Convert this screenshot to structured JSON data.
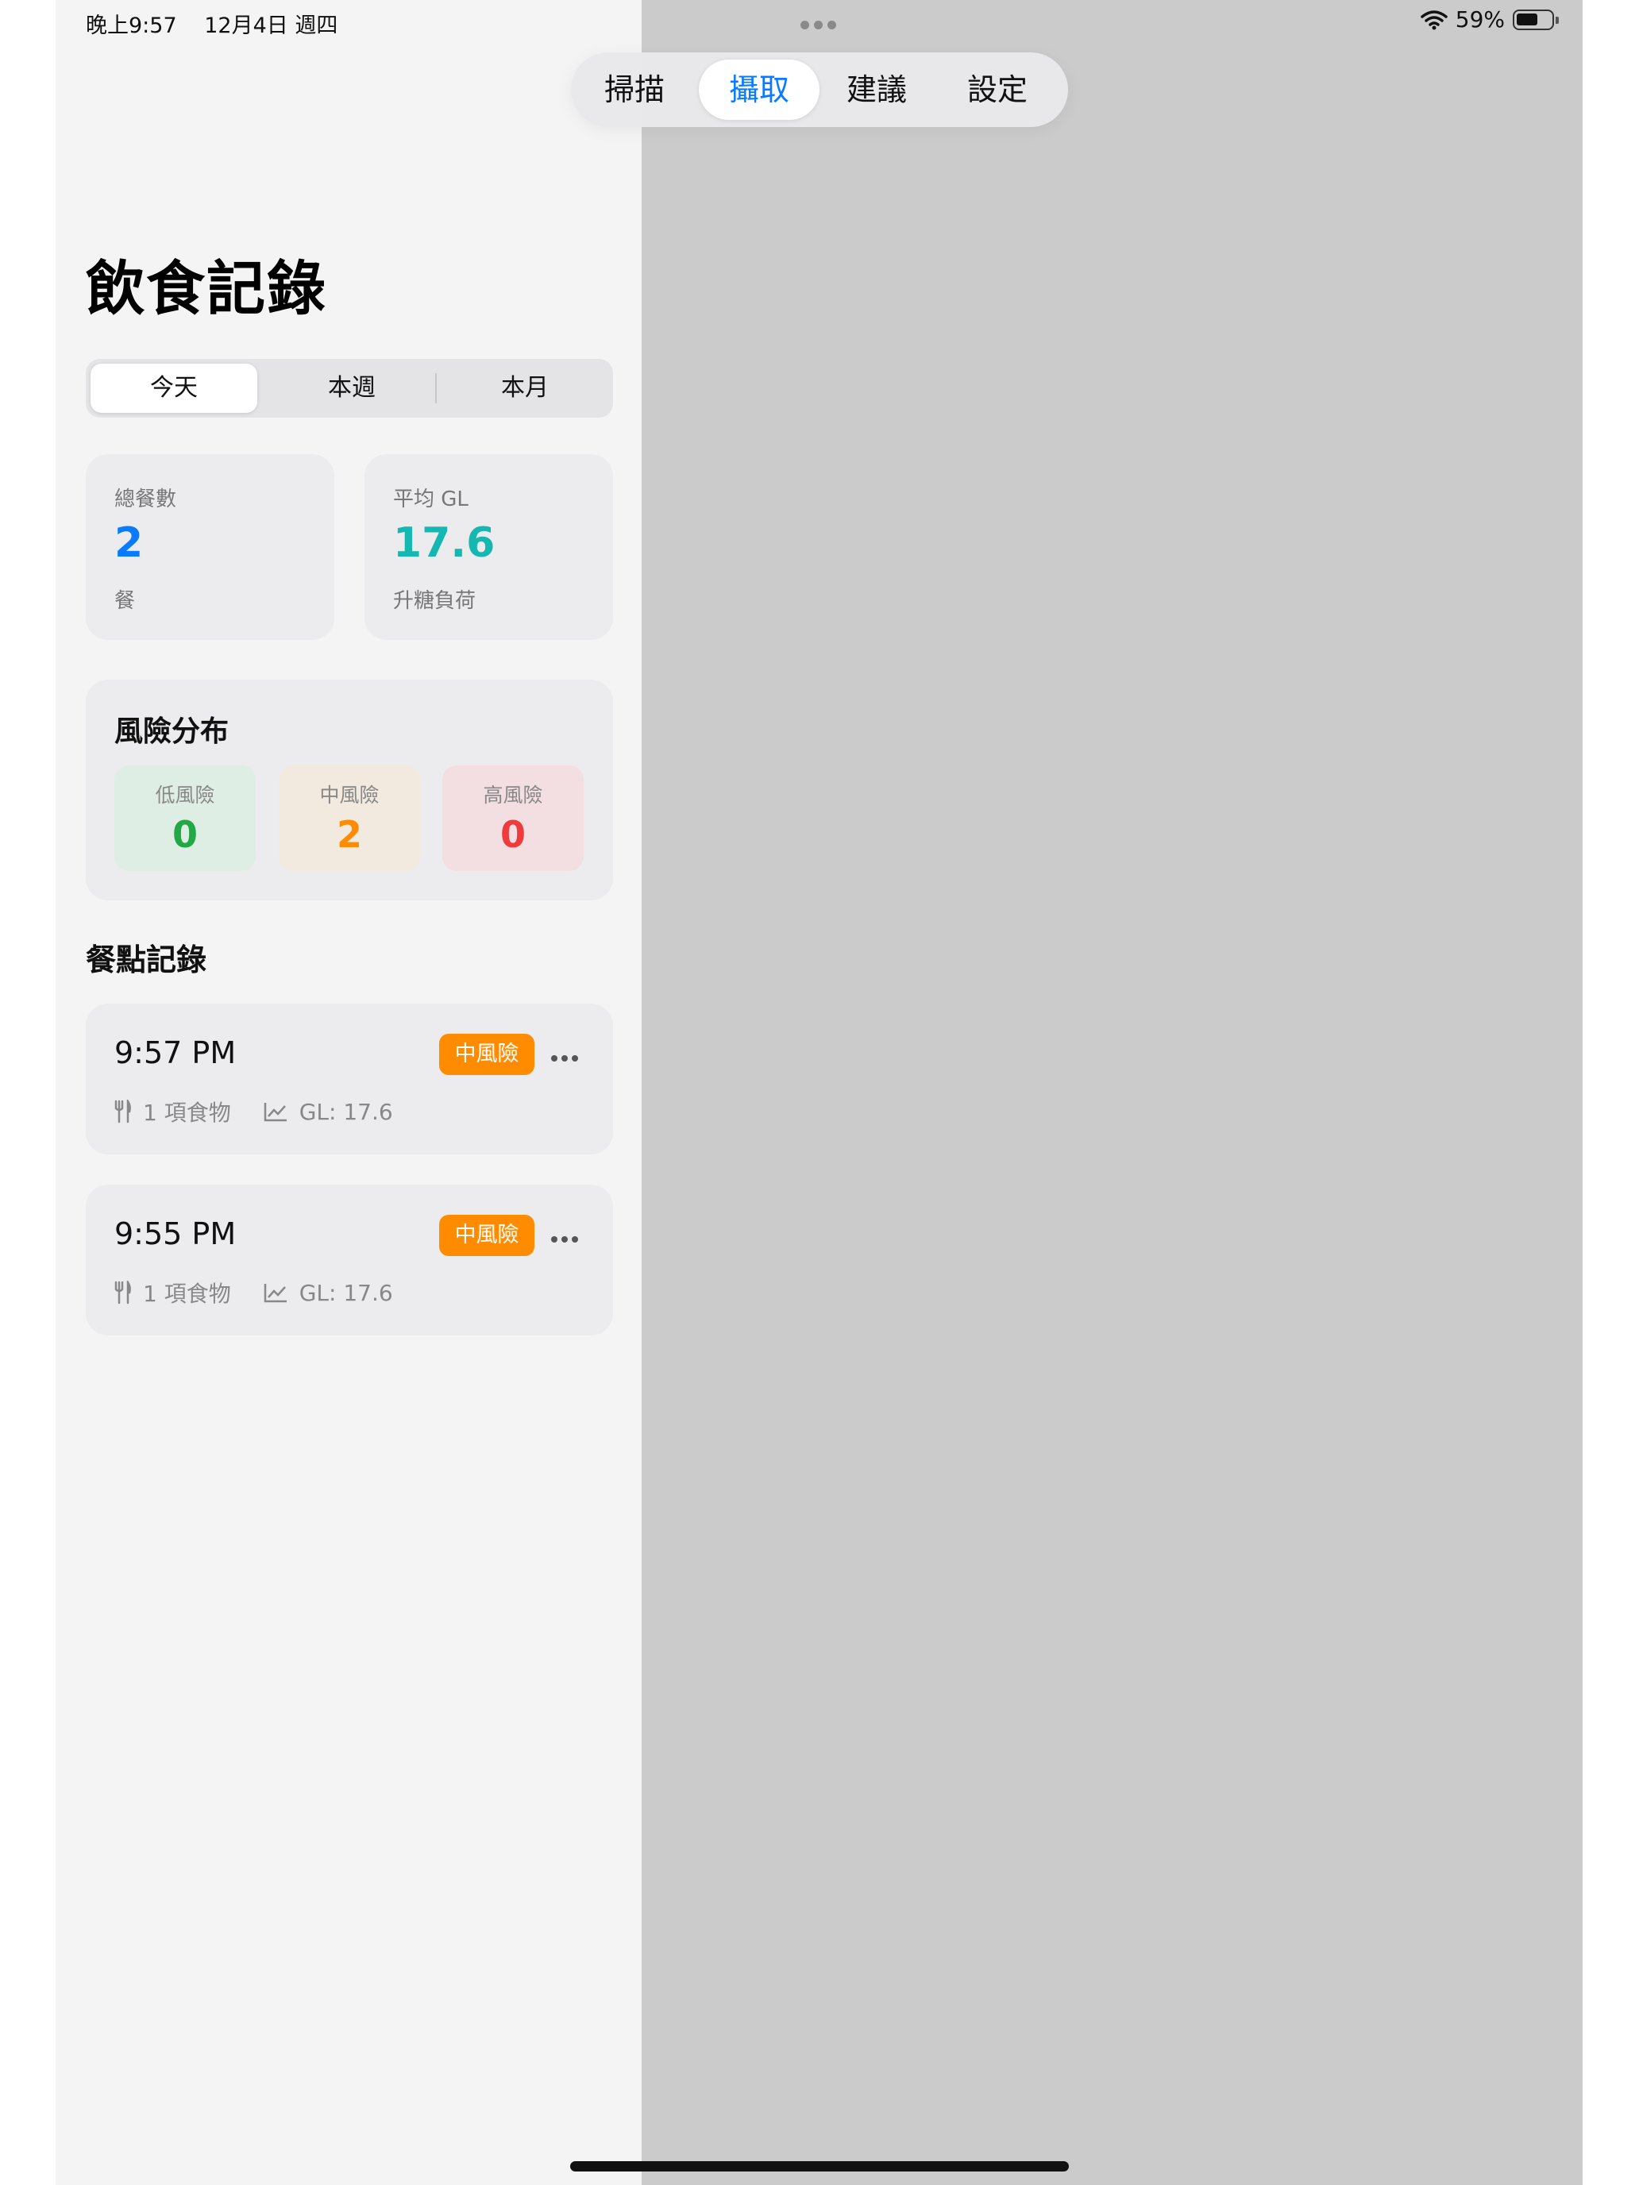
{
  "status_bar": {
    "time": "晚上9:57",
    "date": "12月4日 週四",
    "battery": "59%"
  },
  "tabs": [
    {
      "label": "掃描"
    },
    {
      "label": "攝取"
    },
    {
      "label": "建議"
    },
    {
      "label": "設定"
    }
  ],
  "active_tab": "攝取",
  "page_title": "飲食記錄",
  "segments": [
    {
      "label": "今天"
    },
    {
      "label": "本週"
    },
    {
      "label": "本月"
    }
  ],
  "selected_segment": "今天",
  "stats": {
    "total_meals": {
      "label": "總餐數",
      "value": "2",
      "unit": "餐"
    },
    "avg_gl": {
      "label": "平均 GL",
      "value": "17.6",
      "unit": "升糖負荷"
    }
  },
  "risk_distribution": {
    "title": "風險分布",
    "items": [
      {
        "label": "低風險",
        "value": "0"
      },
      {
        "label": "中風險",
        "value": "2"
      },
      {
        "label": "高風險",
        "value": "0"
      }
    ]
  },
  "meals_section_title": "餐點記錄",
  "meals": [
    {
      "time": "9:57 PM",
      "risk_badge": "中風險",
      "food_count": "1 項食物",
      "gl": "GL: 17.6"
    },
    {
      "time": "9:55 PM",
      "risk_badge": "中風險",
      "food_count": "1 項食物",
      "gl": "GL: 17.6"
    }
  ],
  "colors": {
    "accent_blue": "#0a7aff",
    "teal": "#14b8b0",
    "low": "#22a845",
    "medium": "#ff8c00",
    "high": "#ef3b3b",
    "low_bg": "#dfeee4",
    "medium_bg": "#f2e9df",
    "high_bg": "#f3dfe2"
  },
  "icons": {
    "wifi": "wifi-icon",
    "battery": "battery-icon",
    "fork_knife": "fork-knife-icon",
    "chart": "chart-line-icon",
    "more": "ellipsis-icon"
  }
}
